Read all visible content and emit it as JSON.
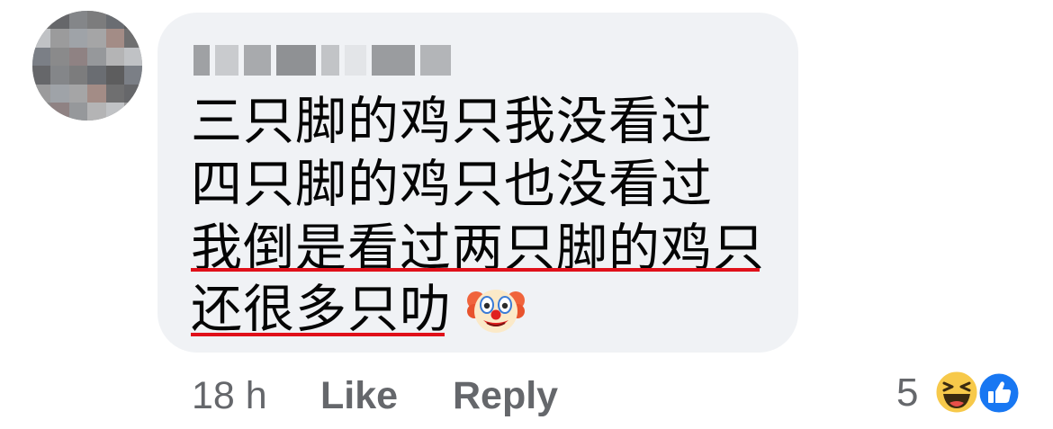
{
  "comment": {
    "text_lines": [
      "三只脚的鸡只我没看过",
      "四只脚的鸡只也没看过",
      "我倒是看过两只脚的鸡只",
      "还很多只叻"
    ],
    "emoji": "clown-face-icon"
  },
  "actions": {
    "timestamp": "18 h",
    "like_label": "Like",
    "reply_label": "Reply"
  },
  "reactions": {
    "count": "5",
    "types": [
      "haha-icon",
      "like-icon"
    ]
  },
  "colors": {
    "bubble": "#f0f2f5",
    "text": "#050505",
    "meta": "#65676b",
    "underline": "#e0101a",
    "like_blue": "#1877f2"
  }
}
